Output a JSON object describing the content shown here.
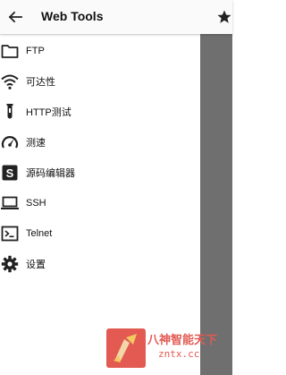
{
  "appbar": {
    "title": "Web Tools"
  },
  "drawer": {
    "items": [
      {
        "label": "FTP",
        "icon": "folder-icon"
      },
      {
        "label": "可达性",
        "icon": "wifi-icon"
      },
      {
        "label": "HTTP测试",
        "icon": "test-tube-icon"
      },
      {
        "label": "测速",
        "icon": "speedometer-icon"
      },
      {
        "label": "源码编辑器",
        "icon": "source-icon"
      },
      {
        "label": "SSH",
        "icon": "laptop-icon"
      },
      {
        "label": "Telnet",
        "icon": "terminal-icon"
      },
      {
        "label": "设置",
        "icon": "gear-icon"
      }
    ]
  },
  "watermark": {
    "text": "八神智能天下",
    "sub": "zntx.cc"
  },
  "colors": {
    "scrim": "#6f6f6f",
    "watermark": "#e25a52",
    "icon": "#222222"
  }
}
